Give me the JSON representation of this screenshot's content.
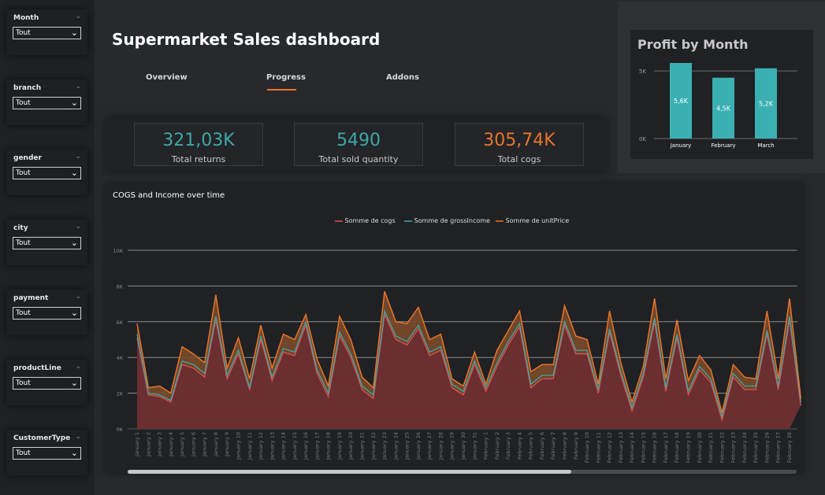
{
  "dashboard": {
    "title": "Supermarket Sales dashboard",
    "tabs": [
      {
        "label": "Overview"
      },
      {
        "label": "Progress"
      },
      {
        "label": "Addons"
      }
    ]
  },
  "slicers": [
    {
      "label": "Month",
      "value": "Tout"
    },
    {
      "label": "branch",
      "value": "Tout"
    },
    {
      "label": "gender",
      "value": "Tout"
    },
    {
      "label": "city",
      "value": "Tout"
    },
    {
      "label": "payment",
      "value": "Tout"
    },
    {
      "label": "productLine",
      "value": "Tout"
    },
    {
      "label": "CustomerType",
      "value": "Tout"
    }
  ],
  "icons": {
    "chevron": "chevron-down-icon",
    "dropdown_arrow": "dropdown-arrow-icon"
  },
  "kpis": [
    {
      "value": "321,03K",
      "caption": "Total returns",
      "color": "#3fa7a8"
    },
    {
      "value": "5490",
      "caption": "Total sold quantity",
      "color": "#3fa7a8"
    },
    {
      "value": "305,74K",
      "caption": "Total cogs",
      "color": "#e8742a"
    }
  ],
  "profit_chart": {
    "title": "Profit by Month",
    "color": "#3ab0b2",
    "chart_data": {
      "type": "bar",
      "categories": [
        "January",
        "February",
        "March"
      ],
      "values": [
        5.6,
        4.5,
        5.2
      ],
      "labels": [
        "5,6K",
        "4,5K",
        "5,2K"
      ],
      "ylim": [
        0,
        6
      ],
      "yticks": [
        {
          "v": 0,
          "label": "0K"
        },
        {
          "v": 5,
          "label": "5K"
        }
      ]
    }
  },
  "line_chart": {
    "title": "COGS  and Income over time",
    "colors": {
      "cogs": "#d9534f",
      "gross": "#3fa7a8",
      "unit": "#e8742a",
      "fill": "#6b2e31",
      "band": "#7a4a2a"
    },
    "chart_data": {
      "type": "area",
      "series_names": [
        "Somme de cogs",
        "Somme de grossIncome",
        "Somme de unitPrice"
      ],
      "ylim": [
        0,
        10000
      ],
      "yticks": [
        {
          "v": 0,
          "label": "0K"
        },
        {
          "v": 2000,
          "label": "2K"
        },
        {
          "v": 4000,
          "label": "4K"
        },
        {
          "v": 6000,
          "label": "6K"
        },
        {
          "v": 8000,
          "label": "8K"
        },
        {
          "v": 10000,
          "label": "10K"
        }
      ],
      "x": [
        "January 1",
        "January 2",
        "January 3",
        "January 4",
        "January 5",
        "January 6",
        "January 7",
        "January 8",
        "January 9",
        "January 10",
        "January 11",
        "January 12",
        "January 13",
        "January 14",
        "January 15",
        "January 16",
        "January 17",
        "January 18",
        "January 19",
        "January 20",
        "January 21",
        "January 22",
        "January 23",
        "January 24",
        "January 25",
        "January 26",
        "January 27",
        "January 28",
        "January 29",
        "January 30",
        "January 31",
        "February 1",
        "February 2",
        "February 3",
        "February 4",
        "February 5",
        "February 6",
        "February 7",
        "February 8",
        "February 9",
        "February 10",
        "February 11",
        "February 12",
        "February 13",
        "February 14",
        "February 15",
        "February 16",
        "February 17",
        "February 18",
        "February 19",
        "February 20",
        "February 21",
        "February 22",
        "February 23",
        "February 24",
        "February 25",
        "February 26",
        "February 27",
        "February 28"
      ],
      "cogs": [
        5100,
        1900,
        1800,
        1500,
        3600,
        3400,
        2900,
        6100,
        2800,
        4200,
        2200,
        5000,
        2700,
        4300,
        4100,
        5800,
        3100,
        1800,
        5200,
        4000,
        2200,
        1700,
        6400,
        5000,
        4700,
        5600,
        4100,
        4400,
        2300,
        1900,
        3600,
        2100,
        3500,
        4700,
        5700,
        2300,
        2800,
        2800,
        5800,
        4200,
        4200,
        2000,
        5400,
        3000,
        1000,
        2900,
        6000,
        2100,
        5100,
        1900,
        3300,
        2600,
        500,
        2900,
        2200,
        2200,
        5300,
        2200,
        6100,
        1300
      ],
      "gross": [
        5300,
        2000,
        1900,
        1600,
        3800,
        3600,
        3100,
        6300,
        3000,
        4400,
        2300,
        5200,
        2900,
        4500,
        4300,
        6000,
        3300,
        2000,
        5400,
        4200,
        2400,
        1900,
        6600,
        5200,
        4900,
        5800,
        4300,
        4600,
        2500,
        2100,
        3800,
        2300,
        3700,
        4900,
        5900,
        2500,
        3000,
        3000,
        6000,
        4400,
        4400,
        2200,
        5600,
        3200,
        1200,
        3100,
        6200,
        2300,
        5300,
        2100,
        3500,
        2800,
        700,
        3100,
        2400,
        2400,
        5500,
        2400,
        6300,
        1500
      ],
      "unit": [
        5900,
        2300,
        2400,
        2000,
        4600,
        4200,
        3700,
        7500,
        3400,
        5100,
        2800,
        5800,
        3400,
        5300,
        5000,
        6400,
        3900,
        2400,
        6300,
        5000,
        2900,
        2300,
        7700,
        6000,
        5900,
        6800,
        5000,
        5300,
        2800,
        2400,
        4300,
        2500,
        4400,
        5500,
        6600,
        3200,
        3600,
        3600,
        6900,
        5200,
        5000,
        2500,
        6600,
        3700,
        1500,
        3500,
        7300,
        2800,
        6100,
        2700,
        4100,
        3300,
        900,
        3600,
        2900,
        2800,
        6600,
        2800,
        7300,
        1700
      ]
    }
  }
}
